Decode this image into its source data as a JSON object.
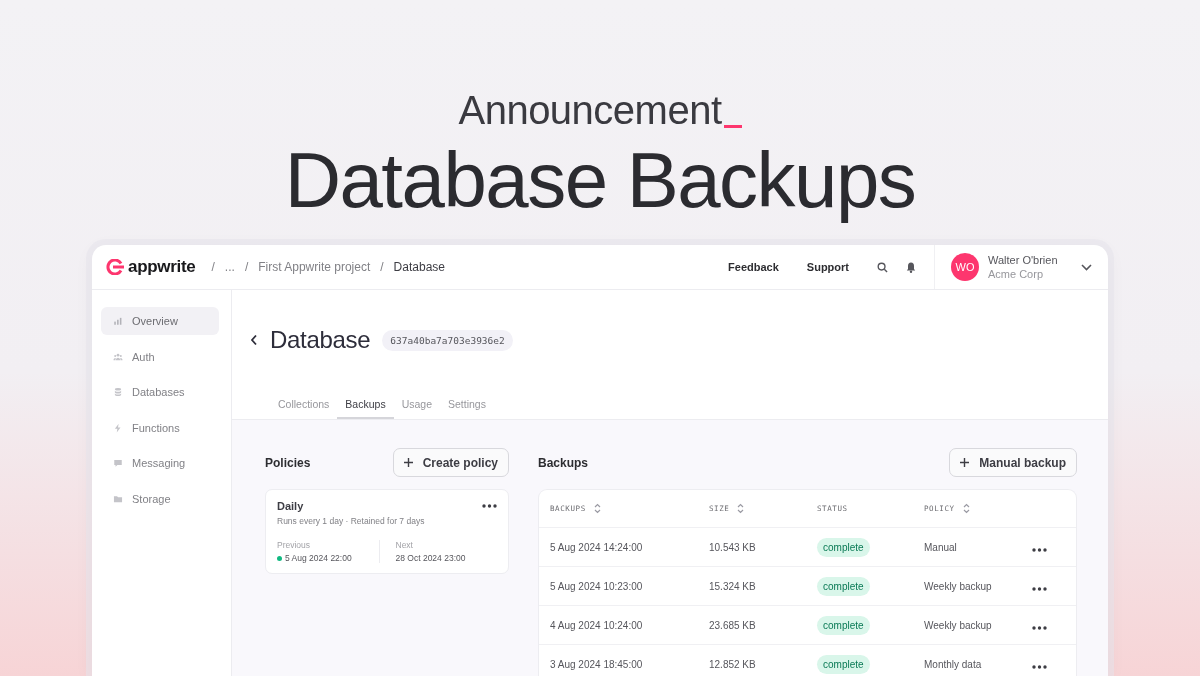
{
  "hero": {
    "eyebrow": "Announcement",
    "title": "Database Backups"
  },
  "topbar": {
    "logo": "appwrite",
    "breadcrumbs": [
      {
        "separator": "/",
        "label": "..."
      },
      {
        "separator": "/",
        "label": "First Appwrite project"
      },
      {
        "separator": "/",
        "label": "Database"
      }
    ],
    "links": [
      "Feedback",
      "Support"
    ],
    "user": {
      "initials": "WO",
      "name": "Walter O'brien",
      "org": "Acme Corp"
    }
  },
  "sidebar": {
    "items": [
      {
        "label": "Overview",
        "selected": true
      },
      {
        "label": "Auth",
        "selected": false
      },
      {
        "label": "Databases",
        "selected": false
      },
      {
        "label": "Functions",
        "selected": false
      },
      {
        "label": "Messaging",
        "selected": false
      },
      {
        "label": "Storage",
        "selected": false
      }
    ]
  },
  "header": {
    "title": "Database",
    "id": "637a40ba7a703e3936e2"
  },
  "tabs": [
    {
      "label": "Collections",
      "selected": false
    },
    {
      "label": "Backups",
      "selected": true
    },
    {
      "label": "Usage",
      "selected": false
    },
    {
      "label": "Settings",
      "selected": false
    }
  ],
  "policies": {
    "title": "Policies",
    "button": "Create policy",
    "items": [
      {
        "name": "Daily",
        "description": "Runs every 1 day · Retained for 7 days",
        "previous": {
          "label": "Previous",
          "value": "5 Aug 2024 22:00",
          "color": "#10b981"
        },
        "next": {
          "label": "Next",
          "value": "28 Oct 2024 23:00"
        }
      }
    ]
  },
  "backups": {
    "title": "Backups",
    "button": "Manual backup",
    "columns": [
      {
        "label": "BACKUPS",
        "sortable": true
      },
      {
        "label": "SIZE",
        "sortable": true
      },
      {
        "label": "STATUS",
        "sortable": false
      },
      {
        "label": "POLICY",
        "sortable": true
      }
    ],
    "rows": [
      {
        "date": "5 Aug 2024 14:24:00",
        "size": "10.543 KB",
        "status": "complete",
        "policy": "Manual"
      },
      {
        "date": "5 Aug 2024 10:23:00",
        "size": "15.324 KB",
        "status": "complete",
        "policy": "Weekly backup"
      },
      {
        "date": "4 Aug 2024 10:24:00",
        "size": "23.685 KB",
        "status": "complete",
        "policy": "Weekly backup"
      },
      {
        "date": "3 Aug 2024 18:45:00",
        "size": "12.852 KB",
        "status": "complete",
        "policy": "Monthly data"
      }
    ]
  }
}
